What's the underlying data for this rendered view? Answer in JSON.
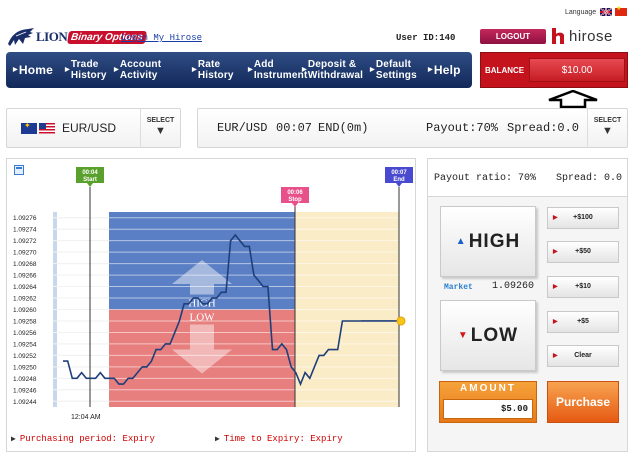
{
  "header": {
    "language_label": "Language",
    "logo_text": "LION",
    "logo_badge": "Binary Options",
    "login_link": "Login My Hirose",
    "user_id": "User ID:140",
    "logout_label": "LOGOUT",
    "hirose_text": "hirose"
  },
  "nav": {
    "home": "Home",
    "trade_history": [
      "Trade",
      "History"
    ],
    "account_activity": [
      "Account",
      "Activity"
    ],
    "rate_history": [
      "Rate",
      "History"
    ],
    "add_instrument": [
      "Add",
      "Instrument"
    ],
    "deposit_withdrawal": [
      "Deposit &",
      "Withdrawal"
    ],
    "default_settings": [
      "Default",
      "Settings"
    ],
    "help": "Help"
  },
  "balance": {
    "label": "BALANCE",
    "value": "$10.00"
  },
  "asset": {
    "pair": "EUR/USD",
    "select_label": "SELECT",
    "time": "00:07",
    "end_label": "END(0m)",
    "payout": "Payout:70%",
    "spread": "Spread:0.0"
  },
  "chart": {
    "start_marker": [
      "00:04",
      "Start"
    ],
    "stop_marker": [
      "00:06",
      "Stop"
    ],
    "end_marker": [
      "00:07",
      "End"
    ],
    "high_label": "HIGH",
    "low_label": "LOW",
    "x_label": "12:04 AM",
    "purchasing_period": "Purchasing period: Expiry",
    "time_to_expiry": "Time to Expiry: Expiry",
    "colors": {
      "high_zone": "#5b7fc4",
      "low_zone": "#e87f7f",
      "expiry_zone": "#fbecc8",
      "line": "#1f3f7a"
    }
  },
  "chart_data": {
    "type": "line",
    "yticks": [
      1.09276,
      1.09274,
      1.09272,
      1.0927,
      1.09268,
      1.09266,
      1.09264,
      1.09262,
      1.0926,
      1.09258,
      1.09256,
      1.09254,
      1.09252,
      1.0925,
      1.09248,
      1.09246,
      1.09244
    ],
    "ylim": [
      1.09243,
      1.09277
    ],
    "y": [
      1.09251,
      1.09251,
      1.09248,
      1.09248,
      1.09249,
      1.09248,
      1.09248,
      1.09248,
      1.09249,
      1.09248,
      1.09248,
      1.09248,
      1.09247,
      1.09247,
      1.09248,
      1.09248,
      1.09249,
      1.0925,
      1.0925,
      1.09251,
      1.09253,
      1.09253,
      1.09254,
      1.09254,
      1.09256,
      1.09258,
      1.09261,
      1.09261,
      1.09262,
      1.09262,
      1.09261,
      1.09261,
      1.09262,
      1.09262,
      1.09263,
      1.09263,
      1.09272,
      1.09273,
      1.09272,
      1.09271,
      1.09271,
      1.09266,
      1.09265,
      1.09264,
      1.09264,
      1.09253,
      1.09253,
      1.09254,
      1.09253,
      1.0925,
      1.09249,
      1.09247,
      1.09249,
      1.09248,
      1.0925,
      1.09252,
      1.09252,
      1.09253,
      1.09253,
      1.09253,
      1.09258,
      1.09258,
      1.09258,
      1.09258,
      1.09258
    ],
    "current_value": 1.0926
  },
  "trade": {
    "payout_ratio": "Payout ratio:  70%",
    "spread": "Spread: 0.0",
    "high_label": "HIGH",
    "low_label": "LOW",
    "market_label": "Market",
    "market_value": "1.09260",
    "amount_buttons": [
      "+$100",
      "+$50",
      "+$10",
      "+$5",
      "Clear"
    ],
    "amount_label": "AMOUNT",
    "amount_value": "$5.00",
    "purchase_label": "Purchase"
  }
}
